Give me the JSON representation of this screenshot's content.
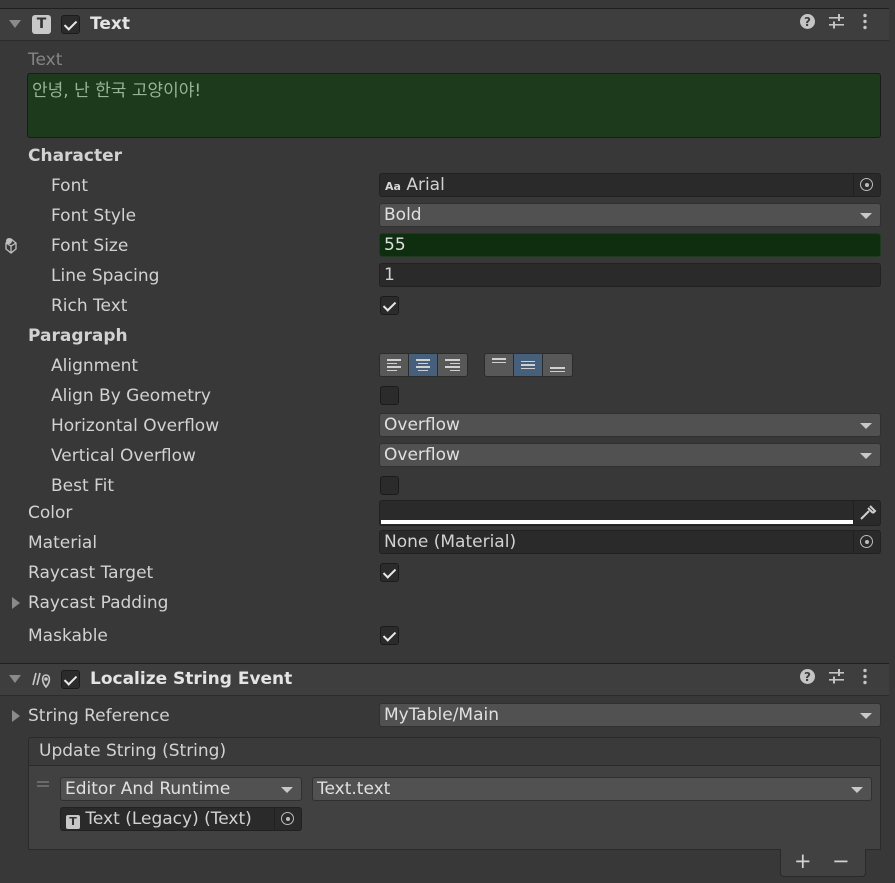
{
  "text_component": {
    "title": "Text",
    "enabled": true,
    "text_label": "Text",
    "text_value": "안녕, 난 한국 고양이야!",
    "character_label": "Character",
    "font_label": "Font",
    "font_value": "Arial",
    "font_glyph": "Aa",
    "font_style_label": "Font Style",
    "font_style_value": "Bold",
    "font_size_label": "Font Size",
    "font_size_value": "55",
    "line_spacing_label": "Line Spacing",
    "line_spacing_value": "1",
    "rich_text_label": "Rich Text",
    "rich_text": true,
    "paragraph_label": "Paragraph",
    "alignment_label": "Alignment",
    "align_by_geometry_label": "Align By Geometry",
    "align_by_geometry": false,
    "horizontal_overflow_label": "Horizontal Overflow",
    "horizontal_overflow_value": "Overflow",
    "vertical_overflow_label": "Vertical Overflow",
    "vertical_overflow_value": "Overflow",
    "best_fit_label": "Best Fit",
    "best_fit": false,
    "color_label": "Color",
    "color_value": "#ffffff",
    "material_label": "Material",
    "material_value": "None (Material)",
    "raycast_target_label": "Raycast Target",
    "raycast_target": true,
    "raycast_padding_label": "Raycast Padding",
    "maskable_label": "Maskable",
    "maskable": true
  },
  "localize_component": {
    "title": "Localize String Event",
    "enabled": true,
    "string_reference_label": "String Reference",
    "string_reference_value": "MyTable/Main",
    "update_string_label": "Update String (String)",
    "event_mode": "Editor And Runtime",
    "event_function": "Text.text",
    "event_target": "Text (Legacy) (Text)",
    "add_symbol": "+",
    "remove_symbol": "−"
  },
  "icons": {
    "help": "help-icon",
    "presets": "presets-icon",
    "menu": "kebab-menu-icon"
  },
  "colors": {
    "background": "#383838",
    "override_green": "#1d3a1d",
    "selected_blue": "#46607c"
  }
}
